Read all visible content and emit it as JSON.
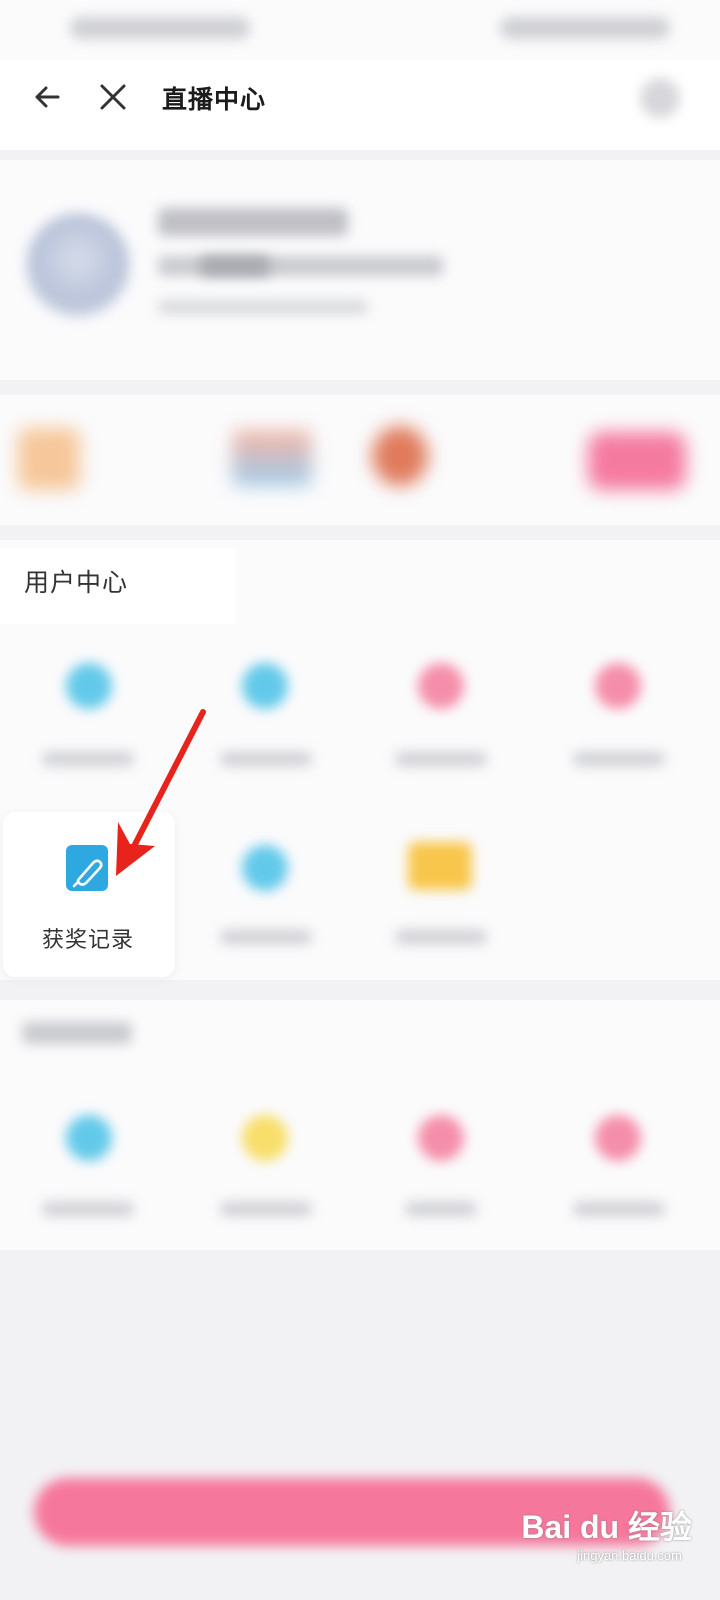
{
  "header": {
    "title": "直播中心"
  },
  "user_center": {
    "section_title": "用户中心",
    "highlighted_item": {
      "label": "获奖记录",
      "icon": "pen-edit-icon"
    }
  },
  "watermark": {
    "brand": "Bai du 经验",
    "url": "jingyan.baidu.com"
  },
  "annotation": {
    "arrow_color": "#e8231b"
  },
  "colors": {
    "accent_pink": "#f6779c",
    "icon_blue": "#2ea8e0"
  }
}
